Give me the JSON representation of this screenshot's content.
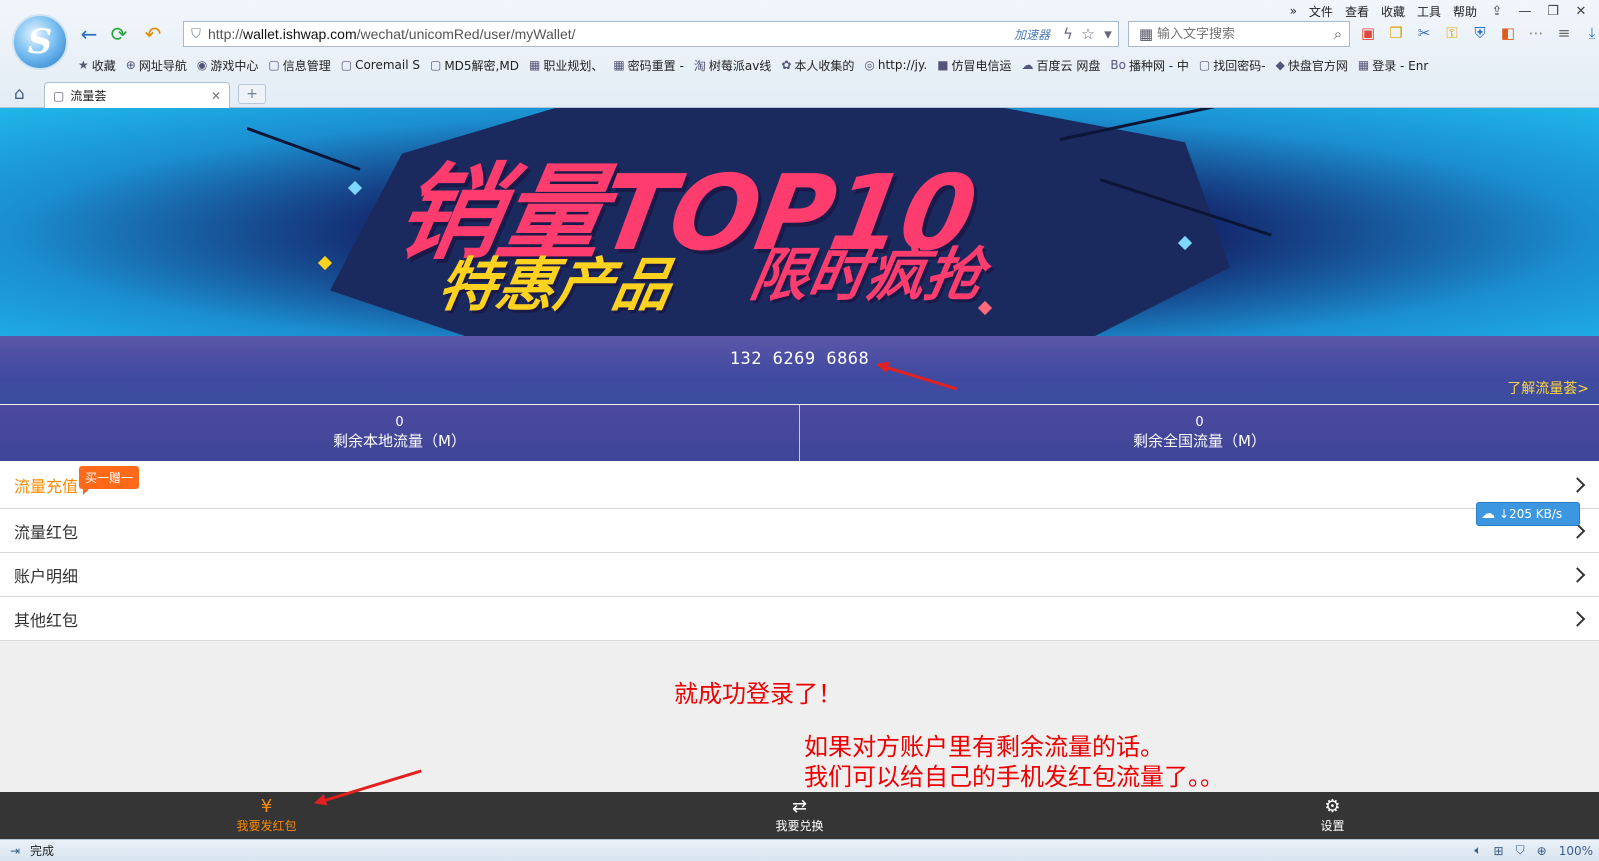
{
  "browser": {
    "menu": [
      "文件",
      "查看",
      "收藏",
      "工具",
      "帮助"
    ],
    "window_controls": [
      "⇪",
      "—",
      "❐",
      "✕"
    ],
    "url": {
      "prefix": "http://",
      "host": "wallet.ishwap.com",
      "path": "/wechat/unicomRed/user/myWallet/"
    },
    "accelerator_label": "加速器",
    "search_placeholder": "输入文字搜索",
    "bookmarks": [
      {
        "icon": "★",
        "label": "收藏"
      },
      {
        "icon": "⊕",
        "label": "网址导航"
      },
      {
        "icon": "◉",
        "label": "游戏中心"
      },
      {
        "icon": "▢",
        "label": "信息管理"
      },
      {
        "icon": "▢",
        "label": "Coremail S"
      },
      {
        "icon": "▢",
        "label": "MD5解密,MD"
      },
      {
        "icon": "▦",
        "label": "职业规划、"
      },
      {
        "icon": "▦",
        "label": "密码重置 -"
      },
      {
        "icon": "淘",
        "label": "树莓派av线"
      },
      {
        "icon": "✿",
        "label": "本人收集的"
      },
      {
        "icon": "◎",
        "label": "http://jy."
      },
      {
        "icon": "■",
        "label": "仿冒电信运"
      },
      {
        "icon": "☁",
        "label": "百度云 网盘"
      },
      {
        "icon": "Bo",
        "label": "播种网 - 中"
      },
      {
        "icon": "▢",
        "label": "找回密码-"
      },
      {
        "icon": "◆",
        "label": "快盘官方网"
      },
      {
        "icon": "▦",
        "label": "登录 - Enr"
      }
    ],
    "tab_title": "流量荟",
    "new_tab_label": "+",
    "status_text": "完成",
    "zoom": "100%",
    "download_speed": "↓205 KB/s"
  },
  "page": {
    "banner": {
      "title": "销量TOP10",
      "subtitle_left": "特惠产品",
      "subtitle_right": "限时疯抢"
    },
    "phone_number": "132 6269 6868",
    "learn_link": "了解流量荟>",
    "traffic": [
      {
        "value": "0",
        "label": "剩余本地流量（M）"
      },
      {
        "value": "0",
        "label": "剩余全国流量（M）"
      }
    ],
    "menu": [
      {
        "label": "流量充值",
        "active": true
      },
      {
        "label": "流量红包",
        "active": false
      },
      {
        "label": "账户明细",
        "active": false
      },
      {
        "label": "其他红包",
        "active": false
      }
    ],
    "promo_badge": "买一赠一",
    "bottom_nav": [
      {
        "icon": "¥",
        "label": "我要发红包",
        "active": true
      },
      {
        "icon": "⇄",
        "label": "我要兑换",
        "active": false
      },
      {
        "icon": "⚙",
        "label": "设置",
        "active": false
      }
    ]
  },
  "annotations": {
    "note1": "就成功登录了！",
    "note2_line1": "如果对方账户里有剩余流量的话。",
    "note2_line2": "我们可以给自己的手机发红包流量了。。",
    "color": "#e00000"
  },
  "colors": {
    "accent": "#ff8a00",
    "band": "#4a4aa0",
    "annotation": "#e00000"
  }
}
